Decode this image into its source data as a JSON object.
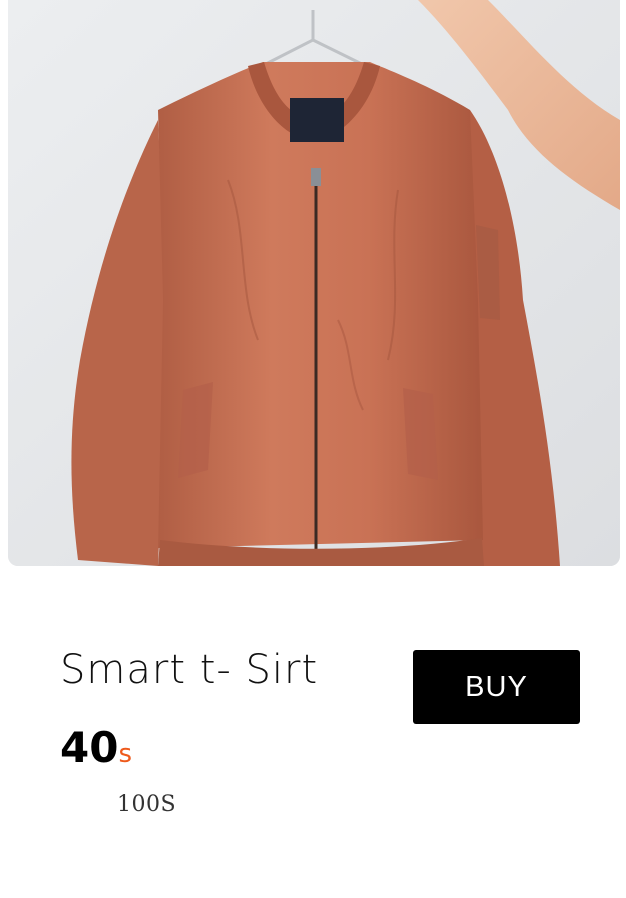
{
  "product": {
    "title": "Smart t- Sirt",
    "price_value": "40",
    "price_currency": "s",
    "old_price": "100S",
    "buy_label": "BUY",
    "image_icon": "jacket-photo"
  },
  "colors": {
    "accent": "#ee5a1c",
    "button_bg": "#000000",
    "button_text": "#ffffff",
    "jacket": "#c46e52"
  }
}
